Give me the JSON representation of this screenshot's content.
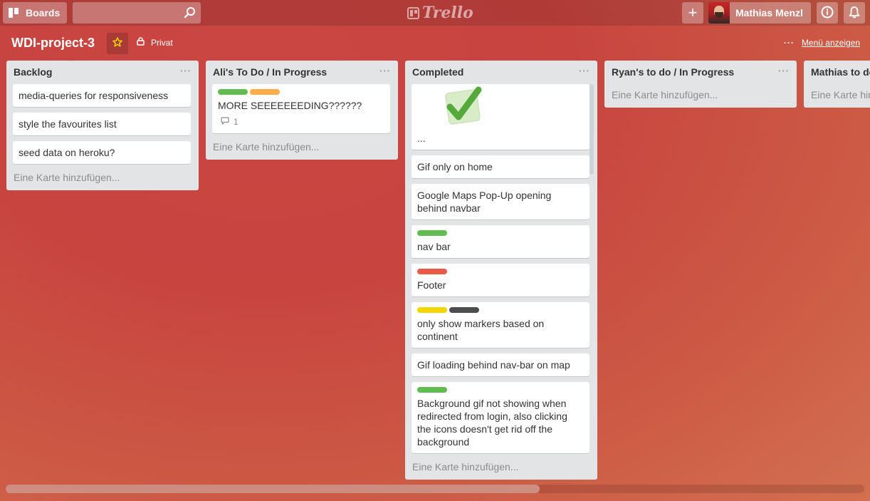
{
  "header": {
    "boards_label": "Boards",
    "search_placeholder": "",
    "logo_text": "Trello",
    "add_label": "+",
    "user_name": "Mathias Menzl"
  },
  "board": {
    "title": "WDI-project-3",
    "visibility": "Privat",
    "menu_label": "Menü anzeigen",
    "menu_dots": "···"
  },
  "lists": [
    {
      "title": "Backlog",
      "menu": "···",
      "cards": [
        {
          "text": "media-queries for responsiveness"
        },
        {
          "text": "style the favourites list"
        },
        {
          "text": "seed data on heroku?"
        }
      ],
      "add_card": "Eine Karte hinzufügen..."
    },
    {
      "title": "Ali's To Do / In Progress",
      "menu": "···",
      "cards": [
        {
          "text": "MORE SEEEEEEEDING??????",
          "labels": [
            "#61bd4f",
            "#ffab4a"
          ],
          "comments": "1"
        }
      ],
      "add_card": "Eine Karte hinzufügen..."
    },
    {
      "title": "Completed",
      "menu": "···",
      "cards": [
        {
          "text": "...",
          "cover": "checkmark"
        },
        {
          "text": "Gif only on home"
        },
        {
          "text": "Google Maps Pop-Up opening behind navbar"
        },
        {
          "text": "nav bar",
          "labels": [
            "#61bd4f"
          ]
        },
        {
          "text": "Footer",
          "labels": [
            "#eb5a46"
          ]
        },
        {
          "text": "only show markers based on continent",
          "labels": [
            "#f2d600",
            "#4d4d4d"
          ]
        },
        {
          "text": "Gif loading behind nav-bar on map"
        },
        {
          "text": "Background gif not showing when redirected from login, also clicking the icons doesn't get rid off the background",
          "labels": [
            "#61bd4f"
          ]
        }
      ],
      "add_card": "Eine Karte hinzufügen..."
    },
    {
      "title": "Ryan's to do / In Progress",
      "menu": "···",
      "cards": [],
      "add_card": "Eine Karte hinzufügen..."
    },
    {
      "title": "Mathias to do",
      "menu": "···",
      "cards": [],
      "add_card": "Eine Karte hinzufügen..."
    }
  ],
  "colors": {
    "background": "#c8443f",
    "list_bg": "#e2e4e6",
    "star": "#f2d600"
  },
  "icons": {
    "boards": "boards-icon",
    "search": "search-icon",
    "info": "info-icon",
    "bell": "bell-icon",
    "star": "star-icon",
    "lock": "lock-icon",
    "comment": "comment-icon"
  }
}
